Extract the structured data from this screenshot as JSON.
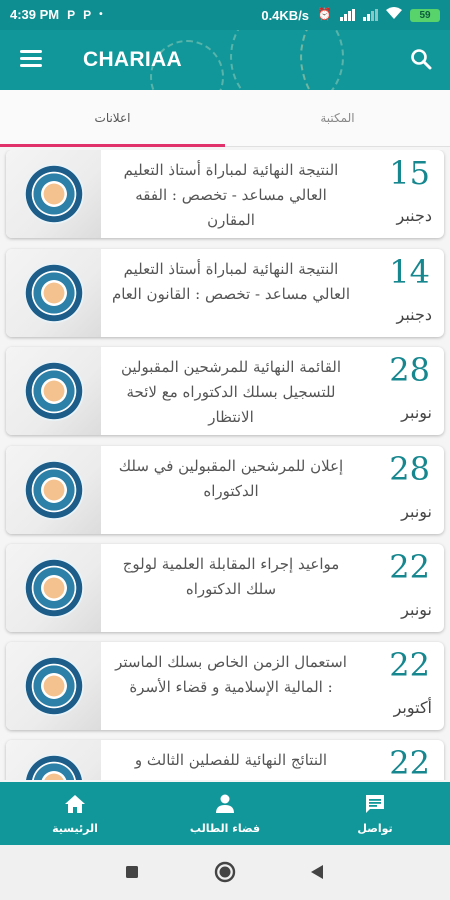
{
  "status_bar": {
    "time": "4:39 PM",
    "left_icons": [
      "P",
      "P"
    ],
    "network_speed": "0.4KB/s",
    "battery": "59"
  },
  "app_bar": {
    "title": "CHARIAA",
    "menu_icon": "menu-icon",
    "search_icon": "search-icon",
    "color": "#11979a"
  },
  "tabs": [
    {
      "label": "اعلانات",
      "selected": true
    },
    {
      "label": "المكتبة",
      "selected": false
    }
  ],
  "announcements": [
    {
      "day": "15",
      "month": "دجنبر",
      "title": "النتيجة النهائية لمباراة أستاذ التعليم العالي مساعد - تخصص : الفقه المقارن"
    },
    {
      "day": "14",
      "month": "دجنبر",
      "title": "النتيجة النهائية لمباراة أستاذ التعليم العالي مساعد - تخصص : القانون العام"
    },
    {
      "day": "28",
      "month": "نونبر",
      "title": "القائمة النهائية للمرشحين المقبولين للتسجيل بسلك الدكتوراه مع لائحة الانتظار"
    },
    {
      "day": "28",
      "month": "نونبر",
      "title": "إعلان للمرشحين المقبولين في سلك الدكتوراه"
    },
    {
      "day": "22",
      "month": "نونبر",
      "title": "مواعيد إجراء المقابلة العلمية لولوج سلك الدكتوراه"
    },
    {
      "day": "22",
      "month": "أكتوبر",
      "title": "استعمال الزمن الخاص بسلك الماستر : المالية الإسلامية و قضاء الأسرة"
    },
    {
      "day": "22",
      "month": "",
      "title": "النتائج النهائية للفصلين الثالث و"
    }
  ],
  "bottom_nav": [
    {
      "label": "تواصل",
      "icon": "chat-icon"
    },
    {
      "label": "فضاء الطالب",
      "icon": "person-icon"
    },
    {
      "label": "الرئيسية",
      "icon": "home-icon"
    }
  ],
  "system_nav": [
    "square-icon",
    "circle-icon",
    "back-triangle-icon"
  ],
  "colors": {
    "primary": "#11979a",
    "accent": "#e2326c",
    "date": "#16878f"
  }
}
